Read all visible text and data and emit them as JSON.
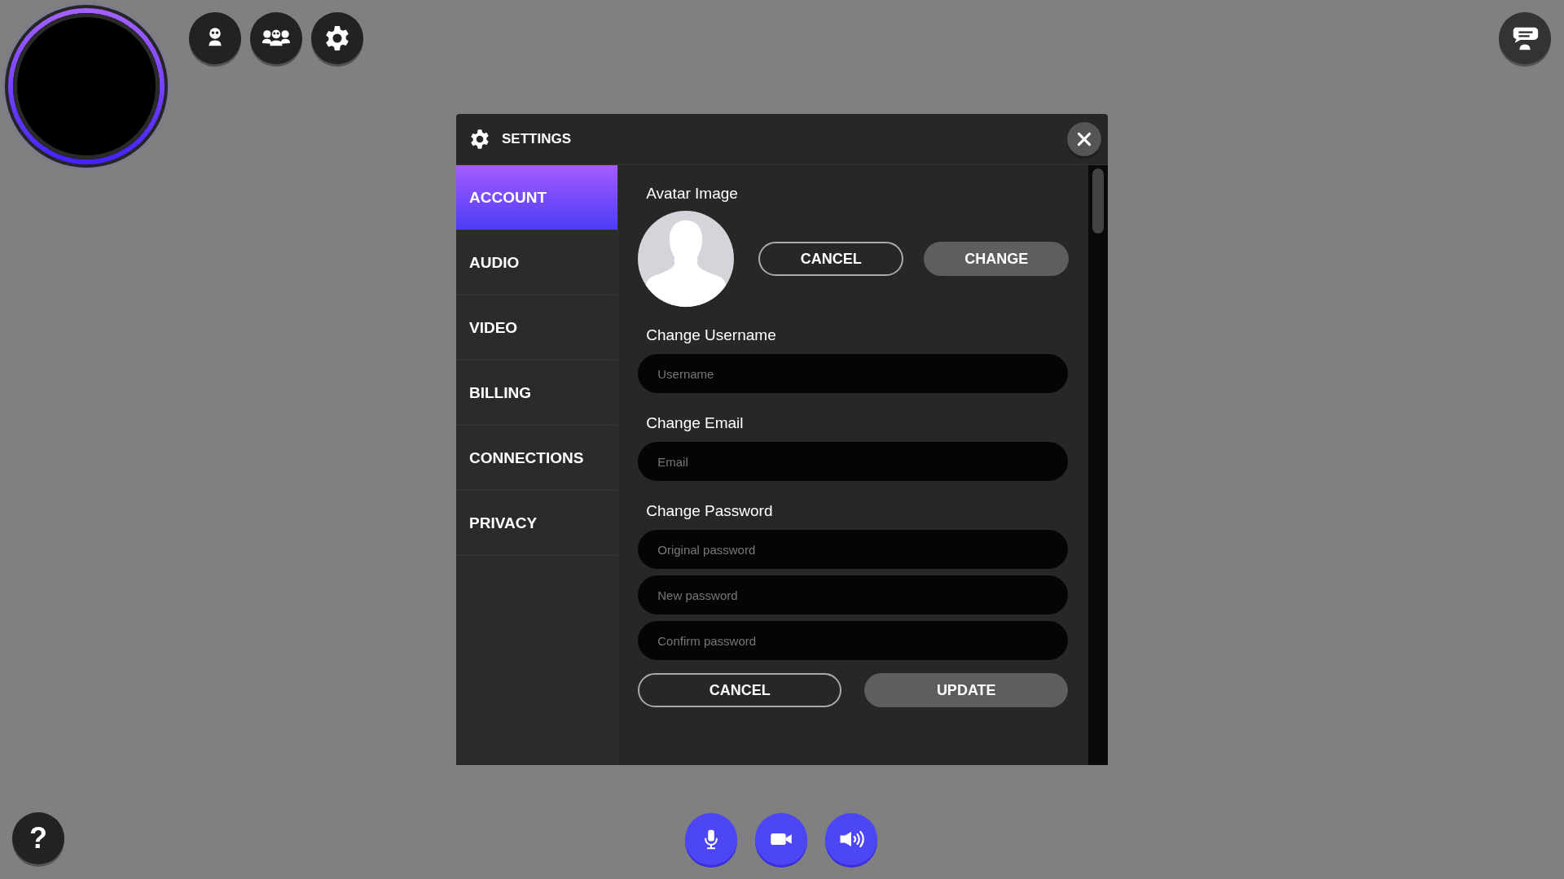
{
  "help_button": {
    "label": "?"
  },
  "dialog": {
    "title": "SETTINGS",
    "tabs": [
      {
        "label": "ACCOUNT",
        "selected": true
      },
      {
        "label": "AUDIO",
        "selected": false
      },
      {
        "label": "VIDEO",
        "selected": false
      },
      {
        "label": "BILLING",
        "selected": false
      },
      {
        "label": "CONNECTIONS",
        "selected": false
      },
      {
        "label": "PRIVACY",
        "selected": false
      }
    ],
    "avatar": {
      "label": "Avatar Image",
      "buttons": [
        {
          "label": "CANCEL",
          "kind": "outline"
        },
        {
          "label": "CHANGE",
          "kind": "filled"
        }
      ]
    },
    "groups": [
      {
        "label": "Change Username",
        "fields": [
          {
            "placeholder": "Username"
          }
        ]
      },
      {
        "label": "Change Email",
        "fields": [
          {
            "placeholder": "Email"
          }
        ]
      },
      {
        "label": "Change Password",
        "fields": [
          {
            "placeholder": "Original password"
          },
          {
            "placeholder": "New password"
          },
          {
            "placeholder": "Confirm password"
          }
        ]
      }
    ],
    "buttons": [
      {
        "label": "CANCEL",
        "kind": "outline"
      },
      {
        "label": "UPDATE",
        "kind": "filled"
      }
    ]
  }
}
